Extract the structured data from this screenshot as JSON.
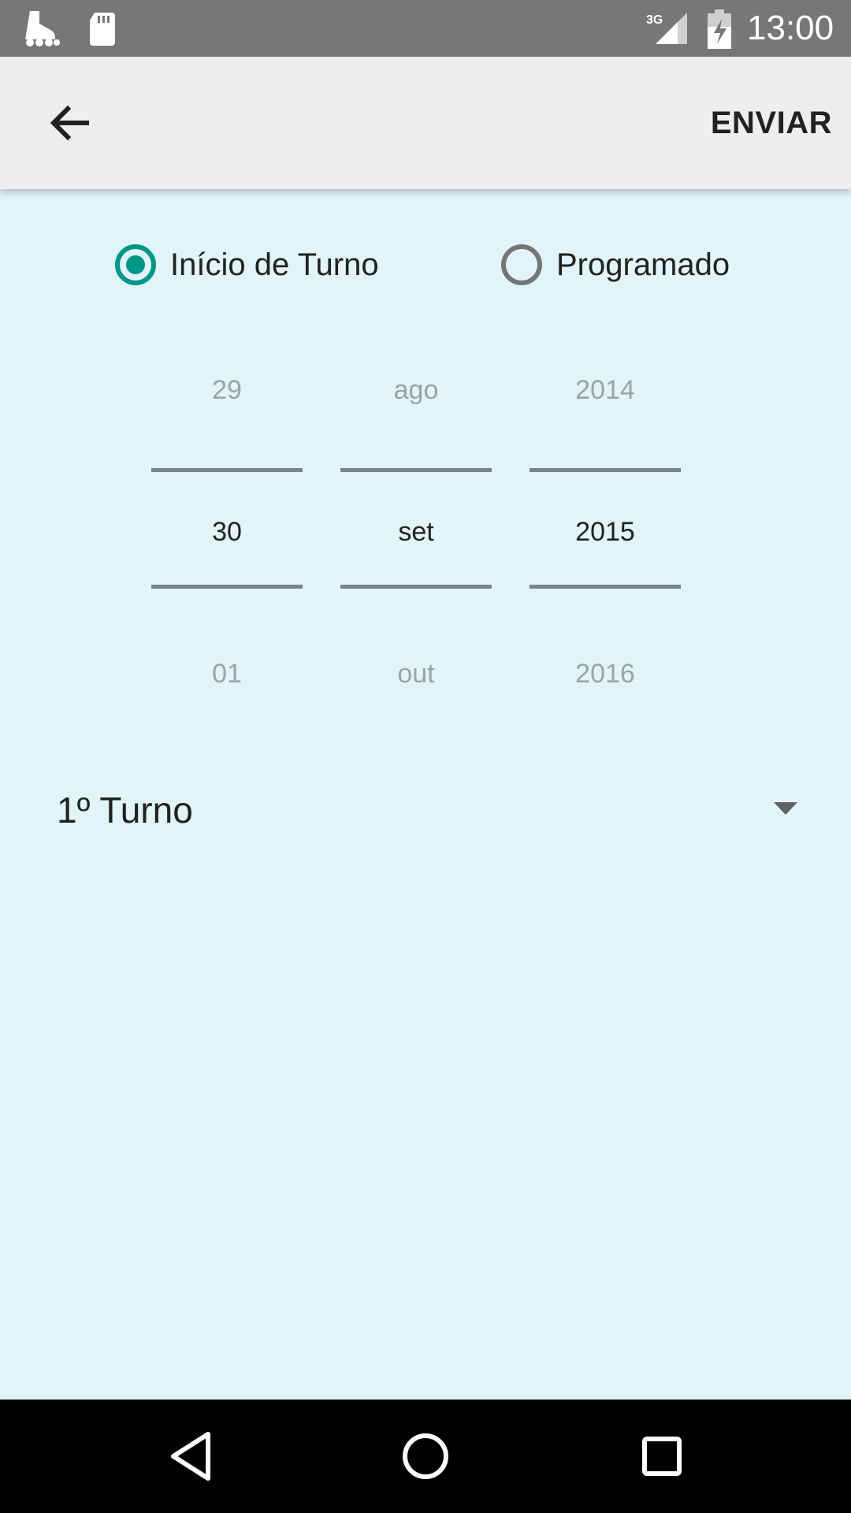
{
  "status_bar": {
    "time": "13:00",
    "network": "3G",
    "left_icons": [
      "skate-icon",
      "sd-card-icon"
    ]
  },
  "app_bar": {
    "back_icon": "arrow-left-icon",
    "send_label": "ENVIAR"
  },
  "mode_options": [
    {
      "label": "Início de Turno",
      "selected": true
    },
    {
      "label": "Programado",
      "selected": false
    }
  ],
  "date_picker": {
    "day": {
      "prev": "29",
      "current": "30",
      "next": "01"
    },
    "month": {
      "prev": "ago",
      "current": "set",
      "next": "out"
    },
    "year": {
      "prev": "2014",
      "current": "2015",
      "next": "2016"
    }
  },
  "shift_select": {
    "value": "1º Turno"
  },
  "colors": {
    "accent": "#009688",
    "background": "#e1f4f9",
    "app_bar": "#eeeeee",
    "status_bar": "#777777"
  }
}
